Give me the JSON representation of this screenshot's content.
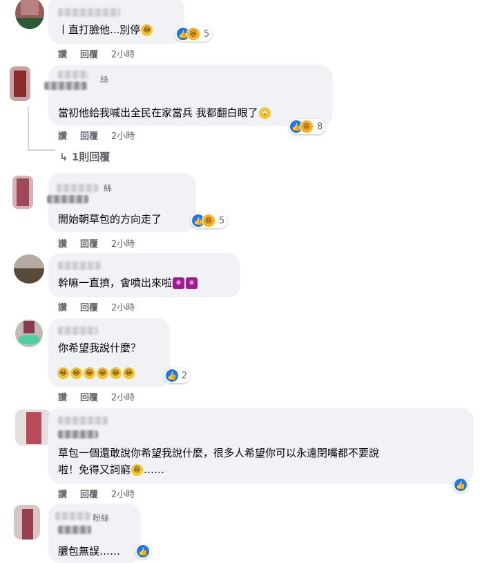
{
  "actions": {
    "like": "讚",
    "reply": "回覆"
  },
  "comments": [
    {
      "badge": "",
      "text": "丨直打臉他...別停",
      "emoji": "🤣",
      "reactions": "5",
      "time": "2小時"
    },
    {
      "badge": "絲",
      "text": "當初他給我喊出全民在家當兵 我都翻白眼了",
      "emoji": "🙄",
      "reactions": "8",
      "time": "2小時",
      "replies": "1則回覆"
    },
    {
      "badge": "絲",
      "text": "開始朝草包的方向走了",
      "reactions": "5",
      "time": "2小時"
    },
    {
      "badge": "",
      "text": "幹嘛一直擠，會噴出來啦",
      "time": "2小時"
    },
    {
      "badge": "",
      "text": "你希望我說什麼？",
      "reactions": "2",
      "time": "2小時"
    },
    {
      "badge": "",
      "text_line1": "草包一個還敢說你希望我說什麼，很多人希望你可以永遠閉嘴都不要說",
      "text_line2": "啦！免得又詞窮",
      "ellipsis": "……",
      "time": "2小時"
    },
    {
      "badge": "粉絲",
      "text": "膿包無誤",
      "ellipsis": "……"
    }
  ],
  "icons": {
    "like": "thumbs-up-icon",
    "haha": "laughing-face-icon",
    "reply_arrow": "reply-arrow-icon",
    "firework": "firework-icon"
  },
  "colors": {
    "bubble": "#f0f2f5",
    "like_blue": "#1877f2",
    "muted": "#65676b"
  }
}
